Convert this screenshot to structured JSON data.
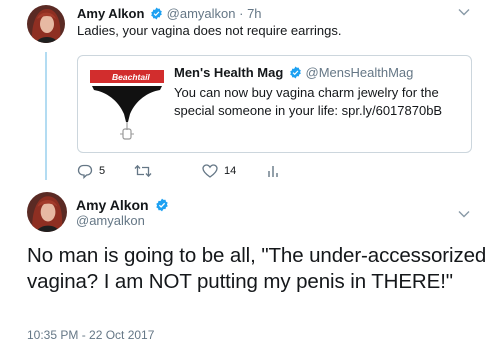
{
  "tweet1": {
    "author": "Amy Alkon",
    "handle": "@amyalkon",
    "time": "· 7h",
    "text": "Ladies, your vagina does not require earrings.",
    "quoted": {
      "author": "Men's Health Mag",
      "handle": "@MensHealthMag",
      "text": "You can now buy vagina charm jewelry for the special someone in your life: spr.ly/6017870bB",
      "media_brand": "Beachtail"
    },
    "reply_count": "5",
    "like_count": "14"
  },
  "tweet2": {
    "author": "Amy Alkon",
    "handle": "@amyalkon",
    "text": "No man is going to be all, \"The under-accessorized vagina? I am NOT putting my penis in THERE!\"",
    "timestamp": "10:35 PM - 22 Oct 2017"
  },
  "colors": {
    "verified_blue": "#1da1f2",
    "thread_line": "#b3dcf2",
    "muted_text": "#657786",
    "brand_red": "#d22d2d"
  },
  "icons": [
    "verified-icon",
    "chevron-down-icon",
    "reply-icon",
    "retweet-icon",
    "like-icon",
    "analytics-icon"
  ]
}
